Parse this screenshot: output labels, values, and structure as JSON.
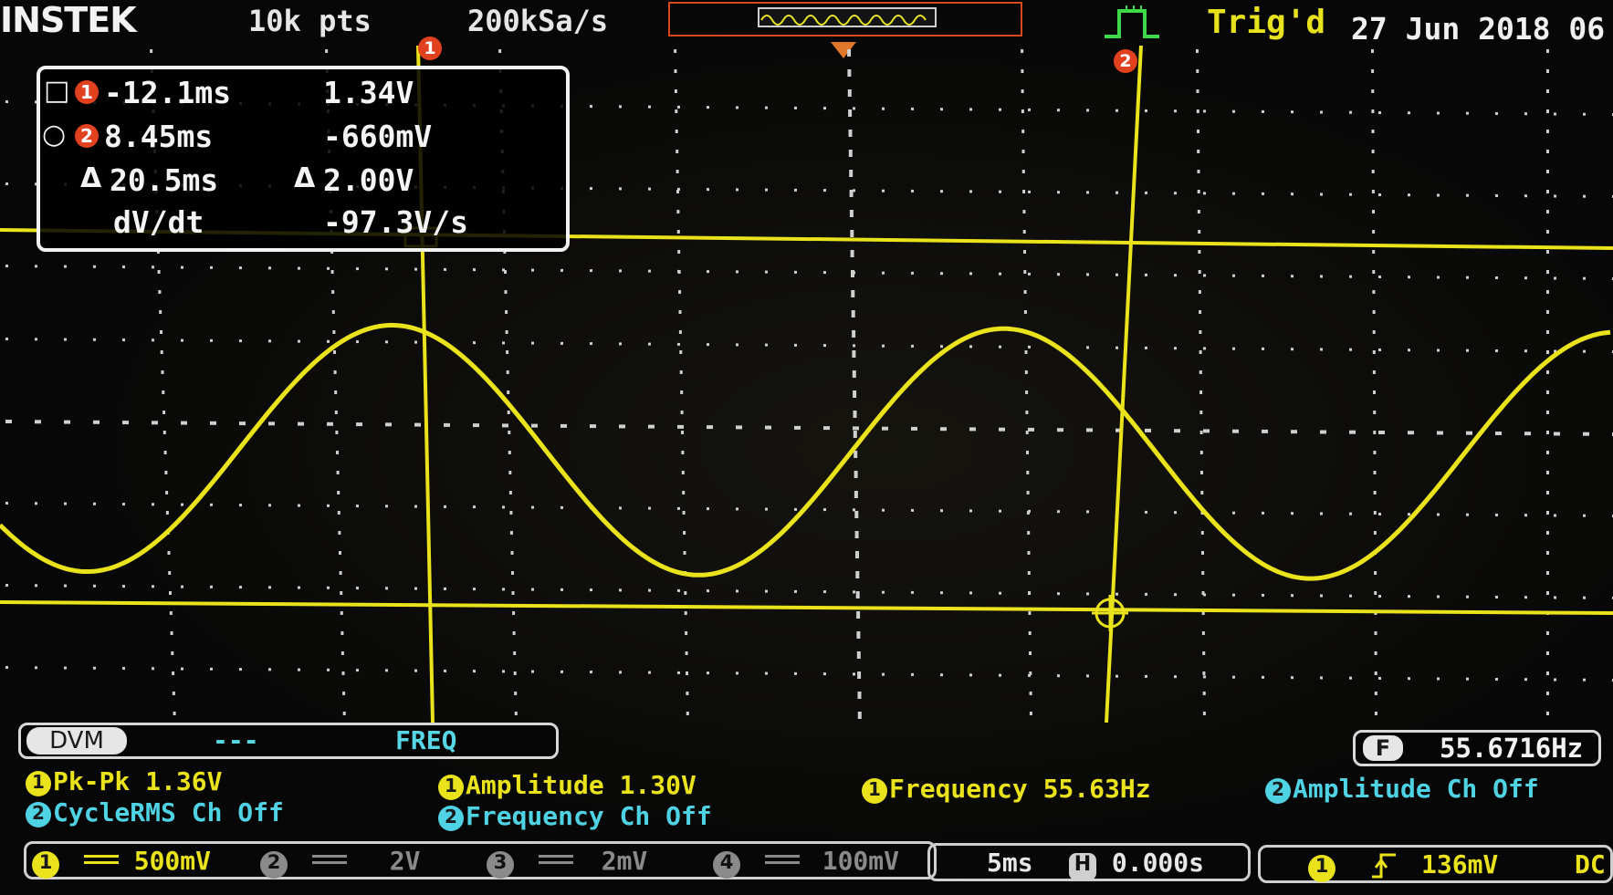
{
  "header": {
    "brand": "INSTEK",
    "record_length": "10k pts",
    "sample_rate": "200kSa/s",
    "trigger_status": "Trig'd",
    "date": "27 Jun 2018 06"
  },
  "cursor_readout": {
    "cursor1": {
      "symbol": "□",
      "channel": "1",
      "time": "-12.1ms",
      "voltage": "1.34V"
    },
    "cursor2": {
      "symbol": "○",
      "channel": "2",
      "time": "8.45ms",
      "voltage": "-660mV"
    },
    "delta": {
      "symbol_t": "Δ",
      "time": "20.5ms",
      "symbol_v": "Δ",
      "voltage": "2.00V"
    },
    "slope": {
      "label": "dV/dt",
      "value": "-97.3V/s"
    }
  },
  "cursor_tags": {
    "c1": "1",
    "c2": "2"
  },
  "dvm": {
    "label": "DVM",
    "value": "---",
    "mode": "FREQ"
  },
  "frequency_counter": {
    "label": "F",
    "value": "55.6716Hz"
  },
  "measurements": [
    {
      "channel": "1",
      "text": "Pk-Pk 1.36V",
      "color": "#eae31c"
    },
    {
      "channel": "1",
      "text": "Amplitude 1.30V",
      "color": "#eae31c"
    },
    {
      "channel": "1",
      "text": "Frequency 55.63Hz",
      "color": "#eae31c"
    },
    {
      "channel": "2",
      "text": "Amplitude Ch Off",
      "color": "#4fd2e3"
    },
    {
      "channel": "2",
      "text": "CycleRMS Ch Off",
      "color": "#4fd2e3"
    },
    {
      "channel": "2",
      "text": "Frequency Ch Off",
      "color": "#4fd2e3"
    }
  ],
  "channels": [
    {
      "num": "1",
      "coupling": "DC",
      "scale": "500mV"
    },
    {
      "num": "2",
      "coupling": "DC",
      "scale": "2V"
    },
    {
      "num": "3",
      "coupling": "DC",
      "scale": "2mV"
    },
    {
      "num": "4",
      "coupling": "DC",
      "scale": "100mV"
    }
  ],
  "timebase": {
    "scale": "5ms",
    "h_icon": "H",
    "position": "0.000s"
  },
  "trigger": {
    "source": "1",
    "slope_icon": "rising-edge-icon",
    "level": "136mV",
    "coupling": "DC"
  },
  "colors": {
    "ch1": "#eae31c",
    "ch2": "#4fd2e3",
    "cursor_tag": "#e2411f",
    "mem_border": "#d8481a"
  }
}
